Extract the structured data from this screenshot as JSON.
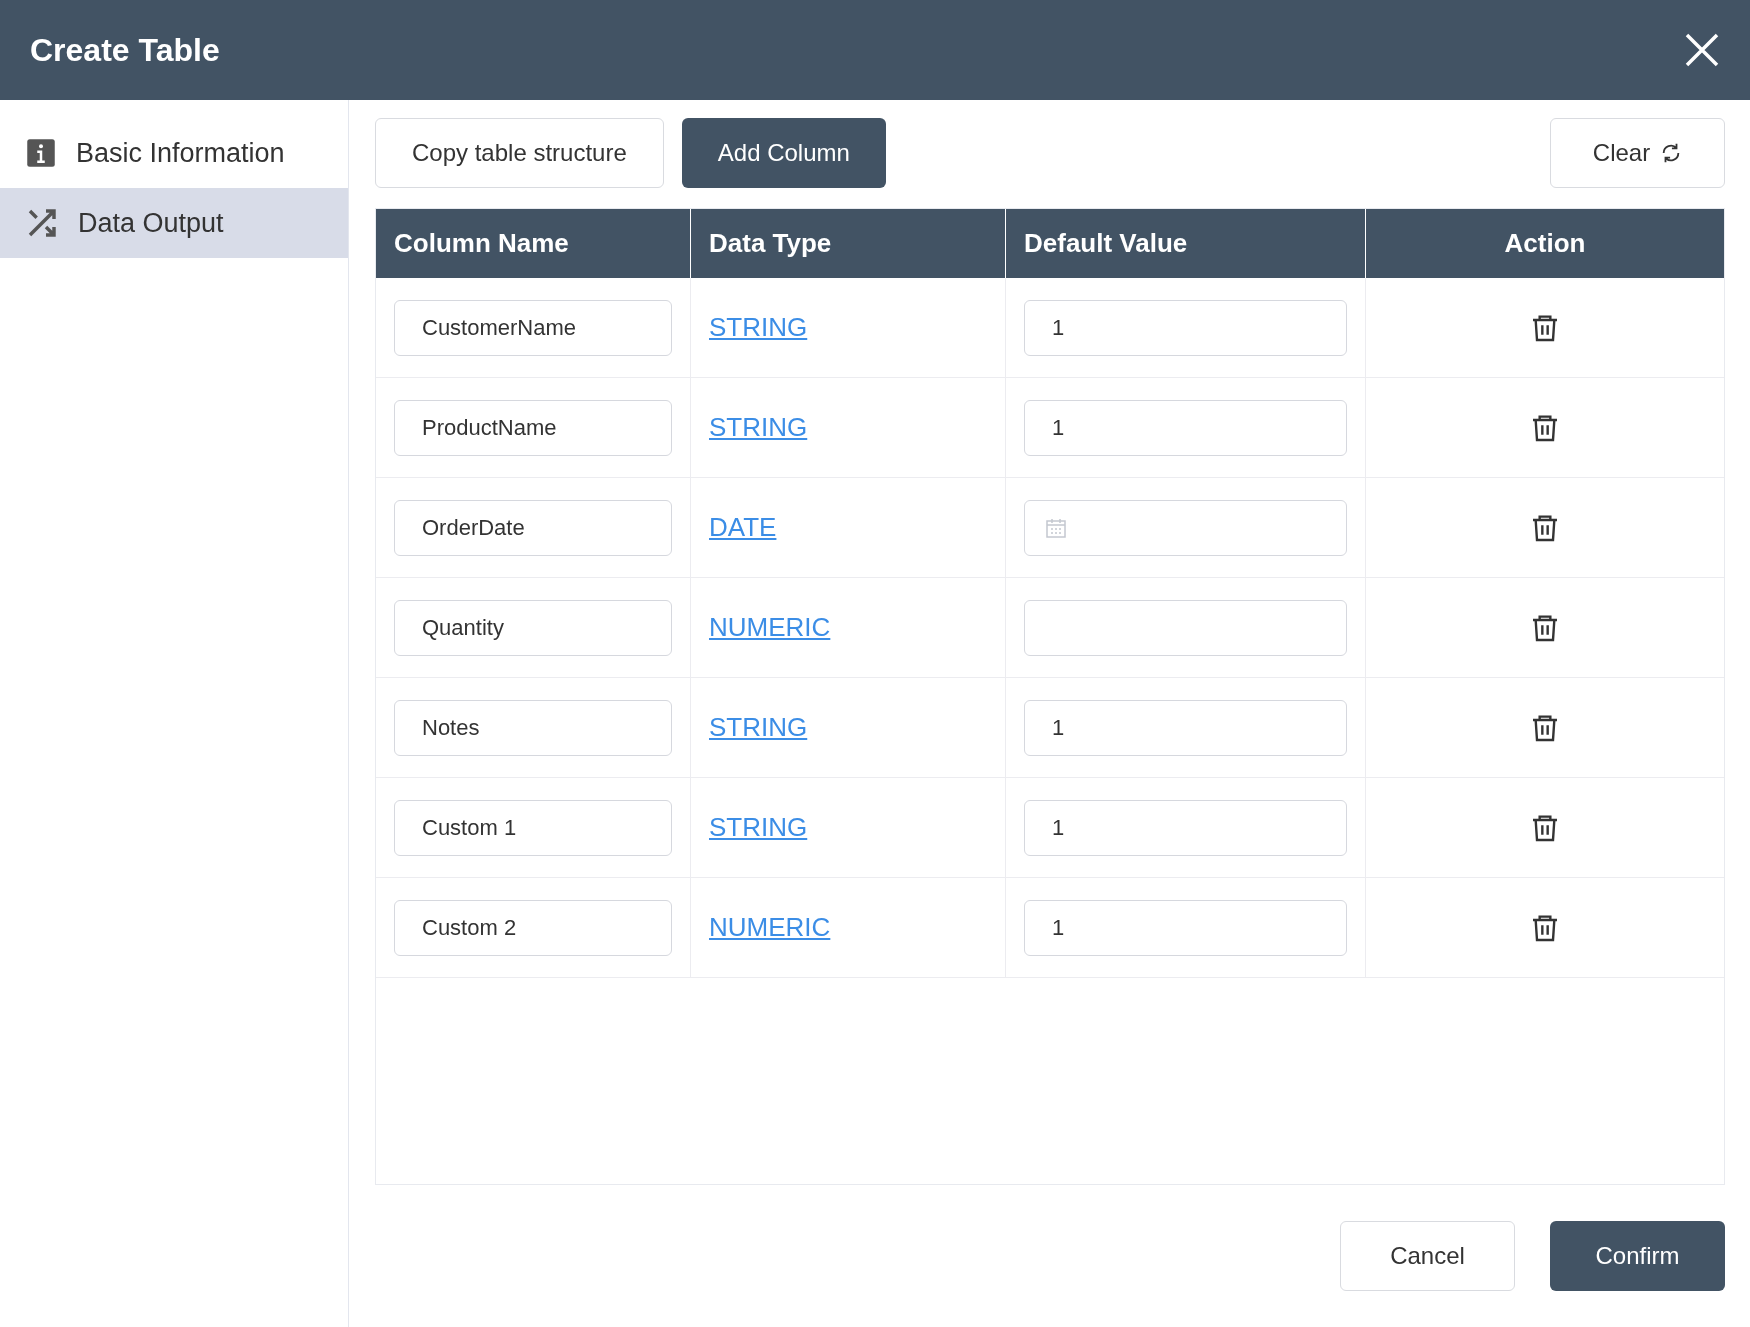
{
  "window": {
    "title": "Create Table"
  },
  "sidebar": {
    "items": [
      {
        "label": "Basic Information",
        "selected": false
      },
      {
        "label": "Data Output",
        "selected": true
      }
    ]
  },
  "toolbar": {
    "copy_button": "Copy table structure",
    "add_button": "Add Column",
    "clear_button": "Clear"
  },
  "table": {
    "columns": [
      "Column Name",
      "Data Type",
      "Default Value",
      "Action"
    ],
    "rows": [
      {
        "name": "CustomerName",
        "type": "STRING",
        "kind": "text",
        "default": "1"
      },
      {
        "name": "ProductName",
        "type": "STRING",
        "kind": "text",
        "default": "1"
      },
      {
        "name": "OrderDate",
        "type": "DATE",
        "kind": "date"
      },
      {
        "name": "Quantity",
        "type": "NUMERIC",
        "kind": "text"
      },
      {
        "name": "Notes",
        "type": "STRING",
        "kind": "text",
        "default": "1"
      },
      {
        "name": "Custom 1",
        "type": "STRING",
        "kind": "text",
        "default": "1"
      },
      {
        "name": "Custom 2",
        "type": "NUMERIC",
        "kind": "text",
        "default": "1"
      }
    ]
  },
  "footer": {
    "cancel": "Cancel",
    "confirm": "Confirm"
  }
}
